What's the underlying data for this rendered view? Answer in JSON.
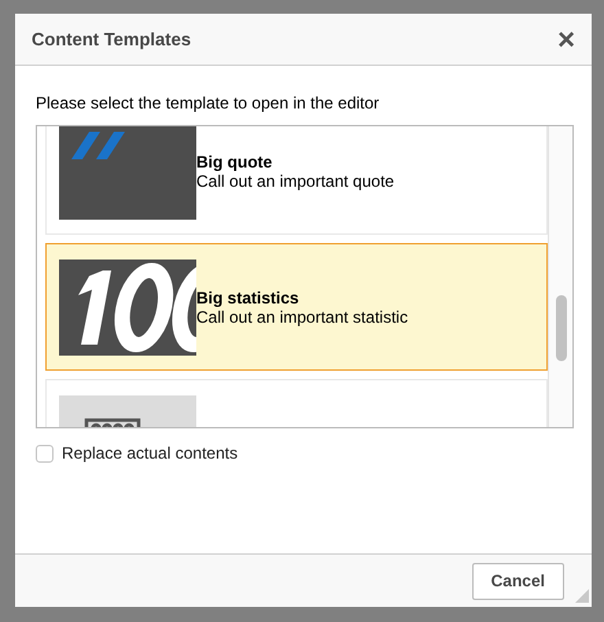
{
  "dialog": {
    "title": "Content Templates",
    "close": "×",
    "instruction": "Please select the template to open in the editor",
    "templates": [
      {
        "kind": "quote",
        "title": "Big quote",
        "description": "Call out an important quote",
        "selected": false
      },
      {
        "kind": "statistic",
        "title": "Big statistics",
        "description": "Call out an important statistic",
        "selected": true
      },
      {
        "kind": "diagram",
        "selected": false
      }
    ],
    "replace_option": {
      "label": "Replace actual contents",
      "checked": false
    },
    "buttons": [
      "Cancel"
    ]
  }
}
